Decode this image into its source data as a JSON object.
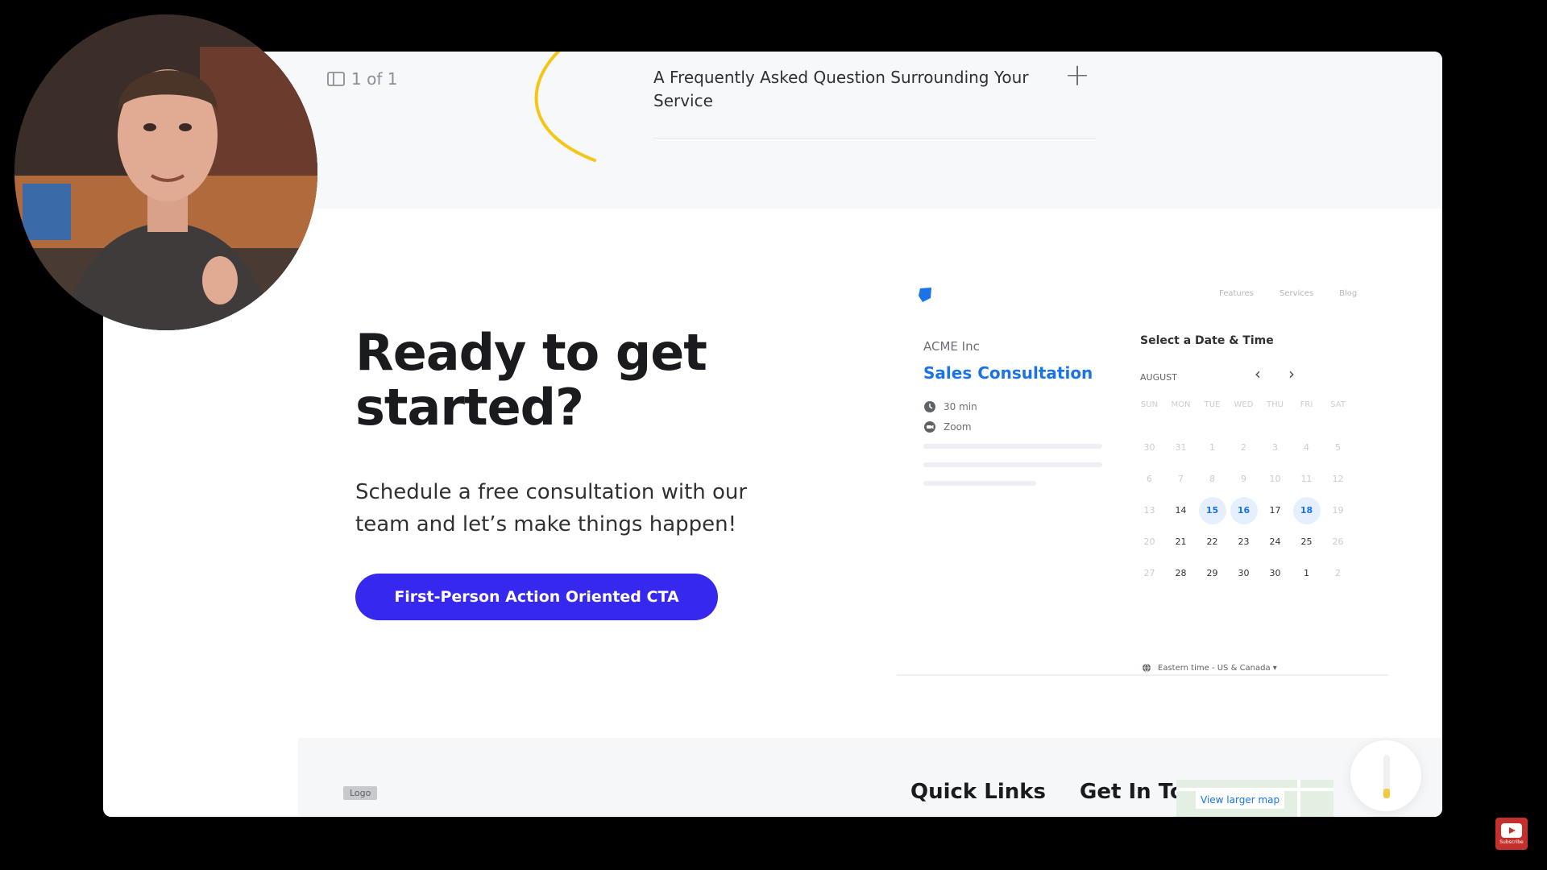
{
  "faq": {
    "page_counter": "1 of 1",
    "question": "A Frequently Asked Question Surrounding Your Service"
  },
  "cta": {
    "title": "Ready to get started?",
    "subtitle": "Schedule a free consultation with our team and let’s make things happen!",
    "button": "First-Person Action Oriented CTA"
  },
  "widget": {
    "nav": [
      "Features",
      "Services",
      "Blog"
    ],
    "company": "ACME Inc",
    "event": "Sales Consultation",
    "duration": "30 min",
    "location": "Zoom",
    "select_title": "Select a Date & Time",
    "month": "AUGUST",
    "weekdays": [
      "SUN",
      "MON",
      "TUE",
      "WED",
      "THU",
      "FRI",
      "SAT"
    ],
    "days": [
      [
        "30",
        "31",
        "1",
        "2",
        "3",
        "4",
        "5"
      ],
      [
        "6",
        "7",
        "8",
        "9",
        "10",
        "11",
        "12"
      ],
      [
        "13",
        "14",
        "15",
        "16",
        "17",
        "18",
        "19"
      ],
      [
        "20",
        "21",
        "22",
        "23",
        "24",
        "25",
        "26"
      ],
      [
        "27",
        "28",
        "29",
        "30",
        "30",
        "1",
        "2"
      ]
    ],
    "available_days": [
      "15",
      "16",
      "18"
    ],
    "timezone": "Eastern time - US & Canada ▾",
    "accent_color": "#1a73e8"
  },
  "footer": {
    "logo": "Logo",
    "quick_links": "Quick Links",
    "get_in_touch": "Get In Touch",
    "map_link": "View larger map"
  },
  "youtube": {
    "subscribe": "Subscribe"
  },
  "colors": {
    "cta_button": "#3628ef",
    "background": "#000000"
  }
}
